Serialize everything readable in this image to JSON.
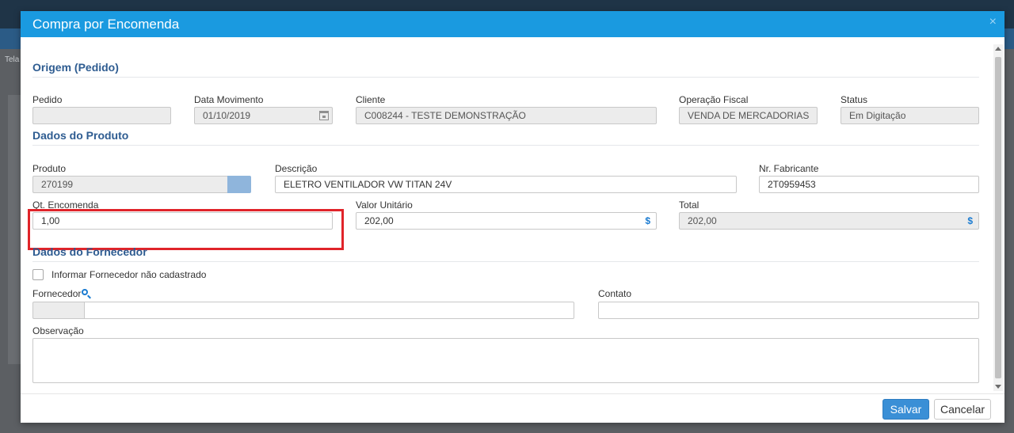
{
  "background": {
    "tab_text": "Tela"
  },
  "modal": {
    "title": "Compra por Encomenda",
    "close_icon": "×"
  },
  "sections": {
    "origem": "Origem (Pedido)",
    "produto": "Dados do Produto",
    "fornecedor": "Dados do Fornecedor"
  },
  "origem": {
    "pedido_label": "Pedido",
    "pedido_value": "",
    "data_label": "Data Movimento",
    "data_value": "01/10/2019",
    "cliente_label": "Cliente",
    "cliente_value": "C008244 - TESTE DEMONSTRAÇÃO",
    "operacao_label": "Operação Fiscal",
    "operacao_value": "VENDA DE MERCADORIAS",
    "status_label": "Status",
    "status_value": "Em Digitação"
  },
  "produto": {
    "produto_label": "Produto",
    "produto_value": "270199",
    "descricao_label": "Descrição",
    "descricao_value": "ELETRO VENTILADOR VW TITAN 24V",
    "fabricante_label": "Nr. Fabricante",
    "fabricante_value": "2T0959453",
    "qt_label": "Qt. Encomenda",
    "qt_value": "1,00",
    "valor_label": "Valor Unitário",
    "valor_value": "202,00",
    "total_label": "Total",
    "total_value": "202,00",
    "currency_symbol": "$"
  },
  "fornecedor": {
    "checkbox_label": "Informar Fornecedor não cadastrado",
    "fornecedor_label": "Fornecedor",
    "fornecedor_code": "",
    "fornecedor_name": "",
    "contato_label": "Contato",
    "contato_value": "",
    "observacao_label": "Observação",
    "observacao_value": ""
  },
  "footer": {
    "save_label": "Salvar",
    "cancel_label": "Cancelar"
  },
  "colors": {
    "header": "#1a9ae0",
    "section_title": "#2e5c91",
    "highlight": "#e0242a",
    "save_button": "#3a8fd6"
  }
}
